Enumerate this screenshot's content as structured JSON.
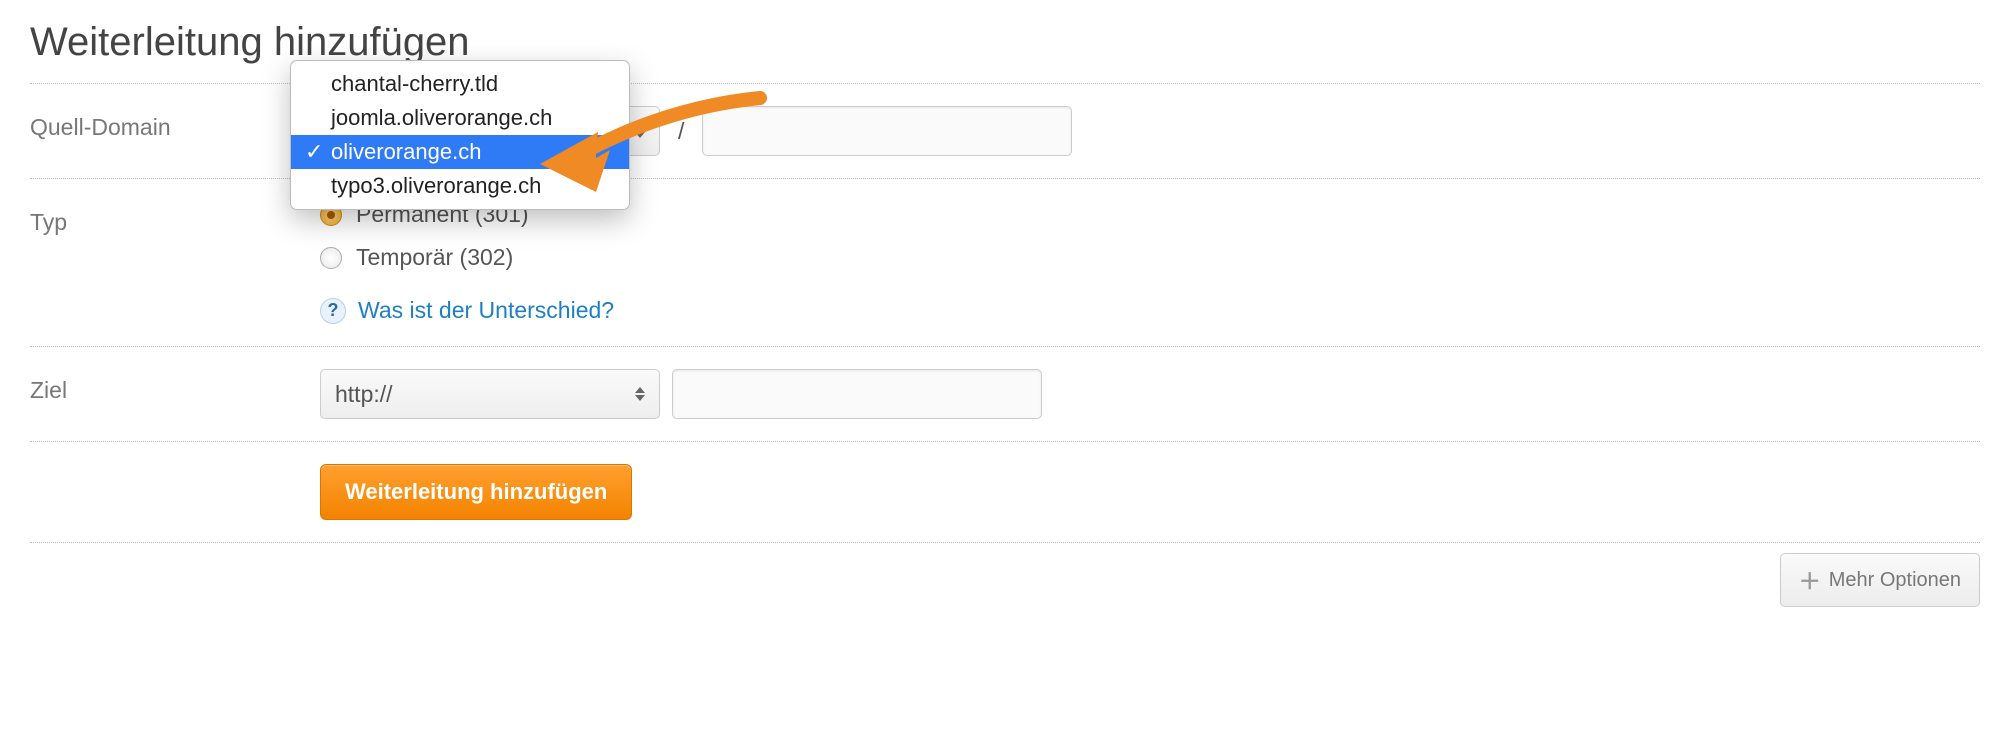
{
  "page_title": "Weiterleitung hinzufügen",
  "labels": {
    "source_domain": "Quell-Domain",
    "type": "Typ",
    "target": "Ziel"
  },
  "separators": {
    "slash": "/"
  },
  "domain_dropdown": {
    "options": [
      "chantal-cherry.tld",
      "joomla.oliverorange.ch",
      "oliverorange.ch",
      "typo3.oliverorange.ch"
    ],
    "selected_index": 2
  },
  "path_input": {
    "value": ""
  },
  "type_options": {
    "permanent": "Permanent (301)",
    "temporary": "Temporär (302)",
    "selected": "permanent",
    "help_text": "Was ist der Unterschied?"
  },
  "target": {
    "protocol_selected": "http://",
    "url_value": ""
  },
  "buttons": {
    "submit": "Weiterleitung hinzufügen",
    "more_options": "Mehr Optionen"
  }
}
